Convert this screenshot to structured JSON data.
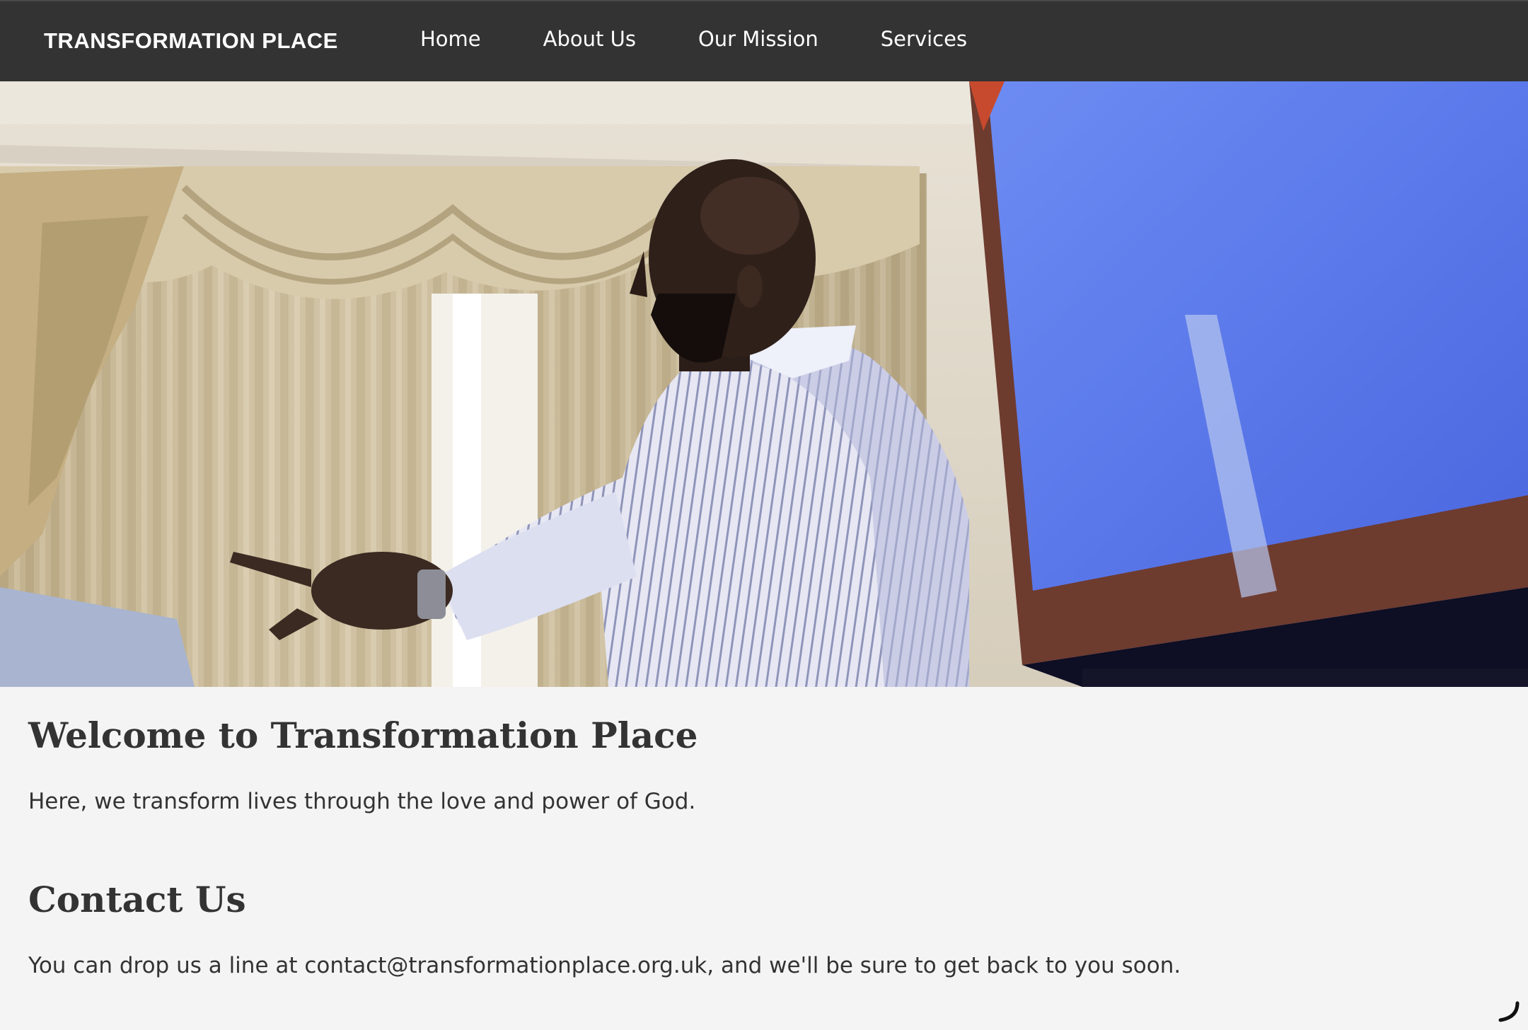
{
  "nav": {
    "brand": "TRANSFORMATION PLACE",
    "links": [
      "Home",
      "About Us",
      "Our Mission",
      "Services"
    ]
  },
  "hero": {
    "image_alt": "Speaker presenting in front of a screen",
    "icon": "hero-photo"
  },
  "welcome": {
    "title": "Welcome to Transformation Place",
    "text": "Here, we transform lives through the love and power of God."
  },
  "contact": {
    "title": "Contact Us",
    "text": "You can drop us a line at contact@transformationplace.org.uk, and we'll be sure to get back to you soon."
  },
  "colors": {
    "nav_bg": "#333333",
    "page_bg": "#f4f4f4",
    "text": "#333333",
    "nav_text": "#ffffff"
  }
}
